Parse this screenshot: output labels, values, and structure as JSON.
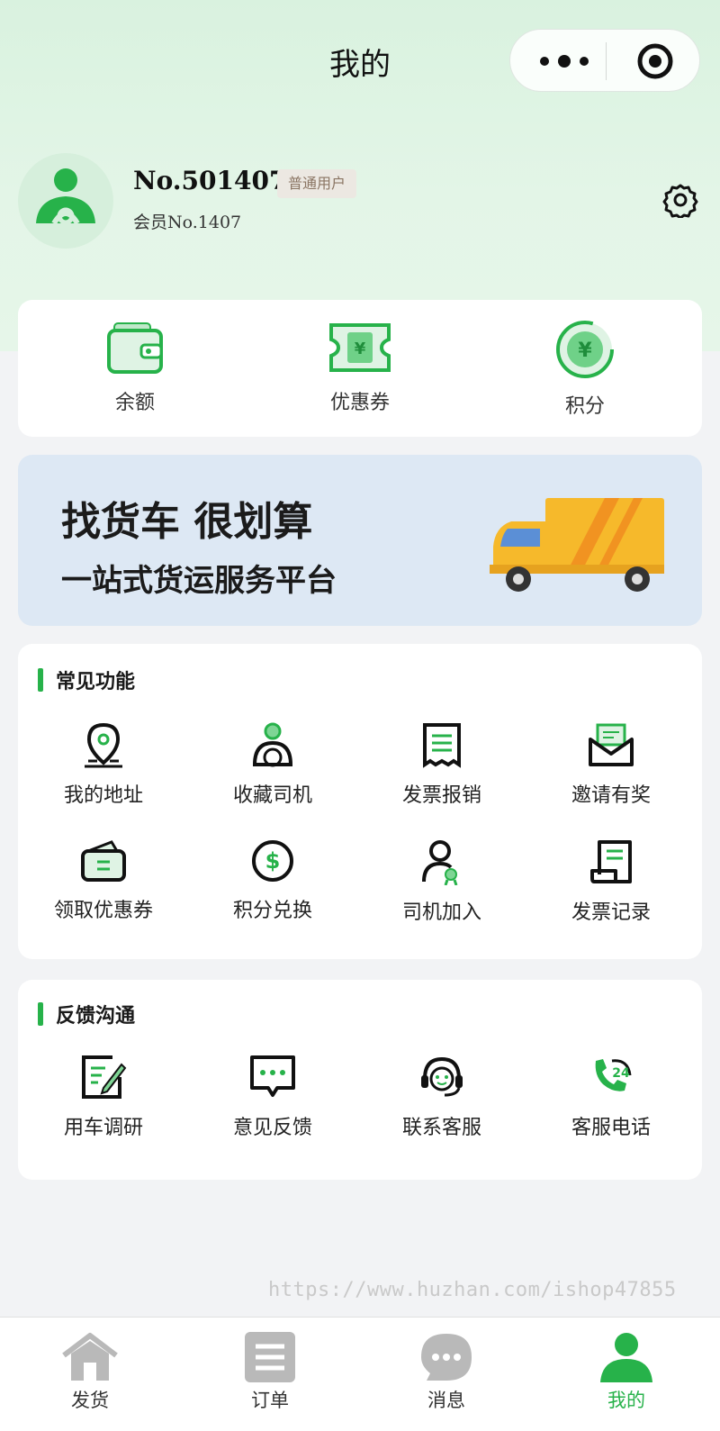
{
  "nav": {
    "title": "我的"
  },
  "user": {
    "name": "No.501407",
    "badge": "普通用户",
    "sub": "会员No.1407"
  },
  "assets": [
    {
      "label": "余额",
      "icon": "wallet-icon"
    },
    {
      "label": "优惠券",
      "icon": "coupon-icon"
    },
    {
      "label": "积分",
      "icon": "points-icon"
    }
  ],
  "banner": {
    "line1": "找货车 很划算",
    "line2": "一站式货运服务平台"
  },
  "common": {
    "title": "常见功能",
    "items": [
      {
        "label": "我的地址",
        "icon": "location-icon"
      },
      {
        "label": "收藏司机",
        "icon": "driver-icon"
      },
      {
        "label": "发票报销",
        "icon": "invoice-icon"
      },
      {
        "label": "邀请有奖",
        "icon": "invite-mail-icon"
      },
      {
        "label": "领取优惠券",
        "icon": "coupon-wallet-icon"
      },
      {
        "label": "积分兑换",
        "icon": "dollar-coin-icon"
      },
      {
        "label": "司机加入",
        "icon": "driver-join-icon"
      },
      {
        "label": "发票记录",
        "icon": "invoice-record-icon"
      }
    ]
  },
  "feedback": {
    "title": "反馈沟通",
    "items": [
      {
        "label": "用车调研",
        "icon": "survey-icon"
      },
      {
        "label": "意见反馈",
        "icon": "chat-bubble-icon"
      },
      {
        "label": "联系客服",
        "icon": "headset-icon"
      },
      {
        "label": "客服电话",
        "icon": "phone-24-icon"
      }
    ]
  },
  "watermark": "https://www.huzhan.com/ishop47855",
  "tabs": [
    {
      "label": "发货",
      "icon": "home-icon",
      "active": false
    },
    {
      "label": "订单",
      "icon": "order-list-icon",
      "active": false
    },
    {
      "label": "消息",
      "icon": "message-icon",
      "active": false
    },
    {
      "label": "我的",
      "icon": "profile-icon",
      "active": true
    }
  ],
  "colors": {
    "accent": "#27b24a",
    "header_bg": "#dff3e4",
    "page_bg": "#f2f3f5",
    "banner_bg": "#dde8f4",
    "truck": "#f6b92b"
  }
}
